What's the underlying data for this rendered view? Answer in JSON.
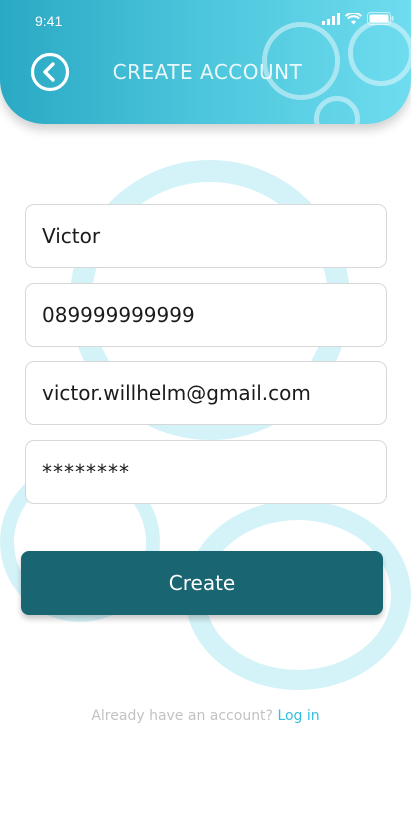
{
  "status_bar": {
    "time": "9:41"
  },
  "header": {
    "title": "CREATE ACCOUNT",
    "back_icon": "chevron-left-icon"
  },
  "form": {
    "name_value": "Victor",
    "phone_value": "089999999999",
    "email_value": "victor.willhelm@gmail.com",
    "password_value": "********"
  },
  "actions": {
    "create_label": "Create"
  },
  "footer": {
    "prompt": "Already have an account?",
    "login_label": "Log in"
  },
  "colors": {
    "header_gradient_start": "#2aa9c4",
    "header_gradient_end": "#6fdcef",
    "button": "#196571",
    "link": "#33bfe0",
    "bubble": "#d4f3f8"
  }
}
